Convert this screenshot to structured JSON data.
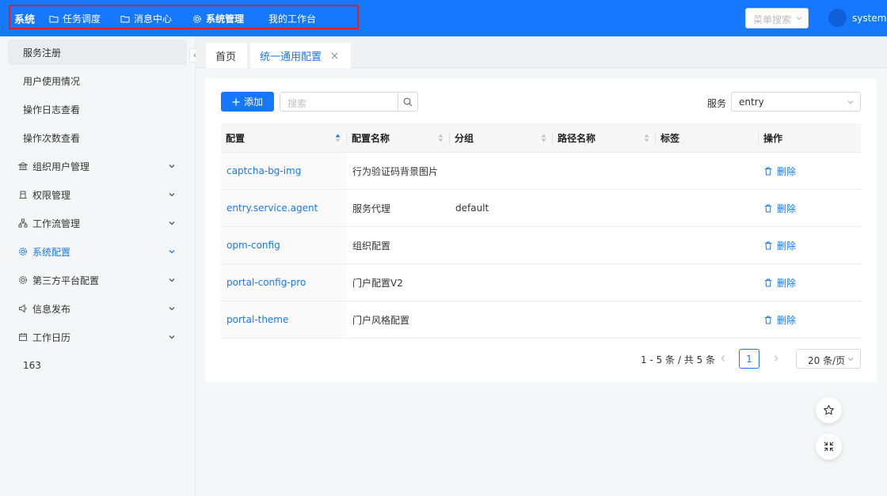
{
  "colors": {
    "primary": "#1677ff",
    "highlight_border": "#e0201b"
  },
  "header": {
    "brand": "系统",
    "nav": [
      {
        "label": "任务调度",
        "icon": "folder-icon"
      },
      {
        "label": "消息中心",
        "icon": "folder-icon"
      },
      {
        "label": "系统管理",
        "icon": "gear-icon",
        "active": true
      },
      {
        "label": "我的工作台",
        "icon": ""
      }
    ],
    "menu_search_placeholder": "菜单搜索",
    "username": "system"
  },
  "sidebar": {
    "items": [
      {
        "label": "服务注册",
        "selected": true
      },
      {
        "label": "用户使用情况"
      },
      {
        "label": "操作日志查看"
      },
      {
        "label": "操作次数查看"
      },
      {
        "label": "组织用户管理",
        "icon": "bank-icon",
        "expandable": true
      },
      {
        "label": "权限管理",
        "icon": "gate-icon",
        "expandable": true
      },
      {
        "label": "工作流管理",
        "icon": "flow-icon",
        "expandable": true
      },
      {
        "label": "系统配置",
        "icon": "gear-icon",
        "expandable": true,
        "active": true
      },
      {
        "label": "第三方平台配置",
        "icon": "gear-icon",
        "expandable": true
      },
      {
        "label": "信息发布",
        "icon": "speaker-icon",
        "expandable": true
      },
      {
        "label": "工作日历",
        "icon": "calendar-icon",
        "expandable": true
      },
      {
        "label": "163"
      }
    ]
  },
  "tabs": [
    {
      "label": "首页"
    },
    {
      "label": "统一通用配置",
      "active": true,
      "closable": true
    }
  ],
  "toolbar": {
    "add_label": "添加",
    "search_placeholder": "搜索",
    "service_label": "服务",
    "service_value": "entry"
  },
  "table": {
    "columns": [
      "配置",
      "配置名称",
      "分组",
      "路径名称",
      "标签",
      "操作"
    ],
    "rows": [
      {
        "key": "captcha-bg-img",
        "name": "行为验证码背景图片",
        "group": "",
        "path": "",
        "tag": "",
        "action": "删除"
      },
      {
        "key": "entry.service.agent",
        "name": "服务代理",
        "group": "default",
        "path": "",
        "tag": "",
        "action": "删除"
      },
      {
        "key": "opm-config",
        "name": "组织配置",
        "group": "",
        "path": "",
        "tag": "",
        "action": "删除"
      },
      {
        "key": "portal-config-pro",
        "name": "门户配置V2",
        "group": "",
        "path": "",
        "tag": "",
        "action": "删除"
      },
      {
        "key": "portal-theme",
        "name": "门户风格配置",
        "group": "",
        "path": "",
        "tag": "",
        "action": "删除"
      }
    ]
  },
  "pagination": {
    "total_text": "1 - 5 条 / 共 5 条",
    "current_page": "1",
    "page_size": "20 条/页"
  }
}
